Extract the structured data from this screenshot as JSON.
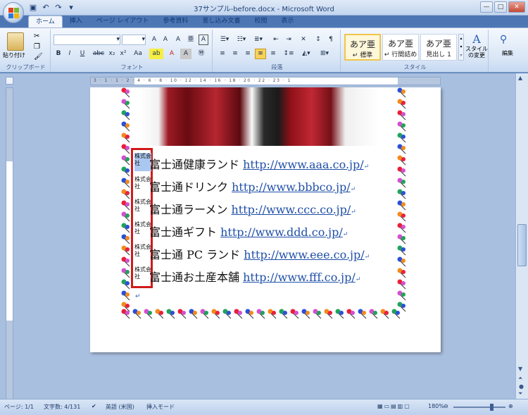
{
  "window": {
    "title": "37サンプル-before.docx - Microsoft Word"
  },
  "qat": [
    "save-icon",
    "undo-icon",
    "redo-icon"
  ],
  "tabs": [
    "ホーム",
    "挿入",
    "ページ レイアウト",
    "参考資料",
    "差し込み文書",
    "校閲",
    "表示"
  ],
  "ribbon": {
    "clipboard": {
      "label": "クリップボード",
      "paste": "貼り付け"
    },
    "font": {
      "label": "フォント",
      "buttons": [
        "B",
        "I",
        "U",
        "abc",
        "x₂",
        "x²",
        "Aa",
        "A",
        "A"
      ]
    },
    "paragraph": {
      "label": "段落"
    },
    "styles": {
      "label": "スタイル",
      "sample": "あア亜",
      "items": [
        "↵ 標準",
        "↵ 行間詰め",
        "見出し 1"
      ],
      "change": "スタイルの変更"
    },
    "editing": {
      "label": "編集"
    }
  },
  "document": {
    "lines": [
      {
        "kabu": "株式会社",
        "name": "富士通健康ランド ",
        "url": "http://www.aaa.co.jp/",
        "mark": "↵"
      },
      {
        "kabu": "株式会社",
        "name": "富士通ドリンク ",
        "url": "http://www.bbbco.jp/",
        "mark": "↵"
      },
      {
        "kabu": "株式会社",
        "name": "富士通ラーメン  ",
        "url": "http://www.ccc.co.jp/",
        "mark": "↵"
      },
      {
        "kabu": "株式会社",
        "name": "富士通ギフト ",
        "url": "http://www.ddd.co.jp/",
        "mark": "↵"
      },
      {
        "kabu": "株式会社",
        "name": "富士通 PC ランド ",
        "url": "http://www.eee.co.jp/",
        "mark": "↵"
      },
      {
        "kabu": "株式会社",
        "name": "富士通お土産本舗 ",
        "url": "http://www.fff.co.jp/",
        "mark": "↵"
      }
    ],
    "empty_mark": "↵"
  },
  "ruler": {
    "marks": "3 · 1 · 1 · 2 · 4 · 6 · 8 · 10 · 12 · 14 · 16 · 18 · 20 · 22 · 23 · 1"
  },
  "status": {
    "page": "ページ: 1/1",
    "words": "文字数: 4/131",
    "lang": "英語 (米国)",
    "mode": "挿入モード",
    "zoom": "180%"
  },
  "colors": {
    "accent": "#1f4fa8",
    "highlight": "#d01a1a",
    "selection": "#aac7ef"
  }
}
